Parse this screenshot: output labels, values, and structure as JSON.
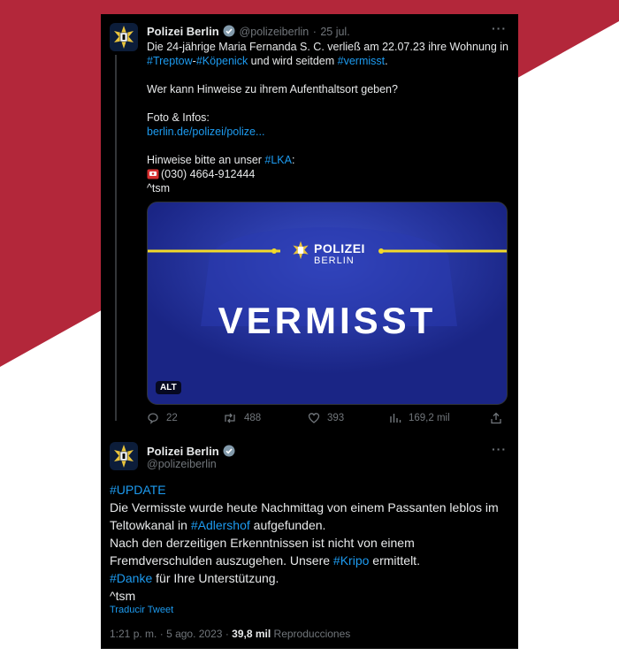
{
  "colors": {
    "backdrop_red": "#b3273a",
    "accent_blue": "#1d9bf0",
    "card_bg": "#000000",
    "banner_blue": "#1f2c9a"
  },
  "tweet1": {
    "name": "Polizei Berlin",
    "handle": "@polizeiberlin",
    "sep": "·",
    "date": "25 jul.",
    "line1": "Die 24-jährige Maria Fernanda S. C. verließ am 22.07.23 ihre Wohnung in",
    "tag_treptow": "#Treptow",
    "dash": "-",
    "tag_koepenick": "#Köpenick",
    "line2_mid": " und wird seitdem ",
    "tag_vermisst": "#vermisst",
    "line2_end": ".",
    "question": "Wer kann Hinweise zu ihrem Aufenthaltsort geben?",
    "foto_label": "Foto & Infos:",
    "foto_link": "berlin.de/polizei/polize...",
    "hinweise": "Hinweise bitte an unser ",
    "tag_lka": "#LKA",
    "colon": ":",
    "phone_icon": "telephone-emoji",
    "phone": "(030) 4664-912444",
    "sign": "^tsm",
    "media": {
      "brand_title": "POLIZEI",
      "brand_sub": "BERLIN",
      "headline": "VERMISST",
      "alt": "ALT"
    },
    "actions": {
      "replies": "22",
      "retweets": "488",
      "likes": "393",
      "views": "169,2 mil"
    }
  },
  "tweet2": {
    "name": "Polizei Berlin",
    "handle": "@polizeiberlin",
    "tag_update": "#UPDATE",
    "line1": "Die Vermisste wurde heute Nachmittag von einem Passanten leblos im",
    "line2_pre": "Teltowkanal in ",
    "tag_adlershof": "#Adlershof",
    "line2_post": " aufgefunden.",
    "line3": "Nach den derzeitigen Erkenntnissen ist nicht von einem",
    "line4_pre": "Fremdverschulden auszugehen. Unsere ",
    "tag_kripo": "#Kripo",
    "line4_post": " ermittelt.",
    "tag_danke": "#Danke",
    "line5_post": " für Ihre Unterstützung.",
    "sign": "^tsm",
    "translate": "Traducir Tweet",
    "time": "1:21 p. m.",
    "sep": "·",
    "date": "5 ago. 2023",
    "sep2": "·",
    "views": "39,8 mil",
    "views_label": "Reproducciones"
  }
}
